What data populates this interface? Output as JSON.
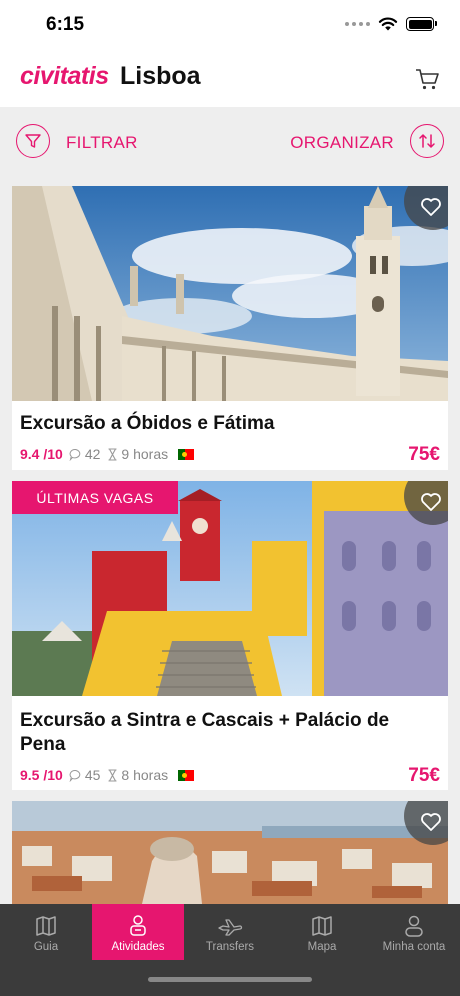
{
  "status": {
    "time": "6:15"
  },
  "header": {
    "brand": "civitatis",
    "city": "Lisboa"
  },
  "filters": {
    "filter_label": "FILTRAR",
    "sort_label": "ORGANIZAR"
  },
  "cards": [
    {
      "title": "Excursão a Óbidos e Fátima",
      "rating": "9.4 /10",
      "reviews": "42",
      "duration": "9 horas",
      "price": "75€",
      "badge": ""
    },
    {
      "title": "Excursão a Sintra e Cascais + Palácio de Pena",
      "rating": "9.5 /10",
      "reviews": "45",
      "duration": "8 horas",
      "price": "75€",
      "badge": "ÚLTIMAS VAGAS"
    },
    {
      "title": "",
      "rating": "",
      "reviews": "",
      "duration": "",
      "price": "",
      "badge": ""
    }
  ],
  "tabs": [
    {
      "label": "Guia",
      "icon": "map-book-icon"
    },
    {
      "label": "Atividades",
      "icon": "person-activities-icon",
      "active": true
    },
    {
      "label": "Transfers",
      "icon": "plane-icon"
    },
    {
      "label": "Mapa",
      "icon": "map-icon"
    },
    {
      "label": "Minha conta",
      "icon": "user-icon"
    }
  ],
  "colors": {
    "accent": "#e6166f",
    "tab_bar": "#3b3b3b",
    "background": "#eeeeee"
  }
}
